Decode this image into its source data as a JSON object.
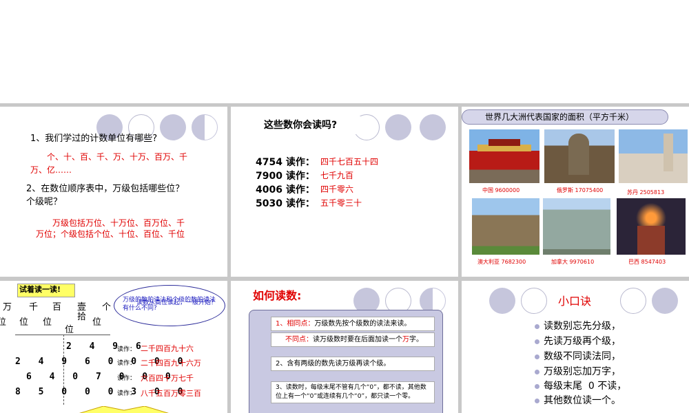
{
  "slide1": {
    "q1": "1、我们学过的计数单位有哪些?",
    "a1": "个、十、百、千、万、十万、百万、千万、亿……",
    "q2": "2、在数位顺序表中，万级包括哪些位？个级呢？",
    "a2": "万级包括万位、十万位、百万位、千万位；个级包括个位、十位、百位、千位"
  },
  "slide2": {
    "title": "这些数你会读吗?",
    "rows": [
      {
        "num": "4754 读作：",
        "ans": "四千七百五十四"
      },
      {
        "num": "7900 读作：",
        "ans": "七千九百"
      },
      {
        "num": "4006 读作：",
        "ans": "四千零六"
      },
      {
        "num": "5030 读作：",
        "ans": "五千零三十"
      }
    ]
  },
  "slide3": {
    "title": "世界几大洲代表国家的面积（平方千米）",
    "captions": [
      "中国  9600000",
      "俄罗斯 17075400",
      "苏丹  2505813",
      "澳大利亚  7682300",
      "加拿大  9970610",
      "巴西  8547403"
    ]
  },
  "slide4": {
    "banner": "试着读一读!",
    "bubble1": "万级的数的读法和个级的数的读法有什么不同?",
    "bubble2": "读数从高位读起，一级开始？",
    "header_top": [
      "万",
      "千",
      "百",
      "壹",
      "个"
    ],
    "header_bottom": [
      "位",
      "位",
      "位",
      "拾",
      "位"
    ],
    "header_extra": "位",
    "numbers": [
      "2 4 9 6",
      "2 4 9 6 0 0 0 0",
      "6 4 0 7 0 0 0",
      "8 5 0 0 0 3 0 0"
    ],
    "read_label": "读作：",
    "answers": [
      "二千四百九十六",
      "二千四百九十六万",
      "六百四十万七千",
      "八千五百万零三百"
    ]
  },
  "slide5": {
    "title": "如何读数:",
    "r1_label": "1、相同点：",
    "r1_text": "万级数先按个级数的读法来读。",
    "r1b_label": "不同点：",
    "r1b_text": "读万级数时要在后面加读一个",
    "r1b_word": "万",
    "r1b_end": "字。",
    "r2": "2、含有两级的数先读万级再读个级。",
    "r3": "3、读数时，每级末尾不管有几个“0”，都不读，其他数位上有一个“0”或连续有几个“0”，都只读一个零。"
  },
  "slide6": {
    "title": "小口诀",
    "lines": [
      "读数别忘先分级，",
      "先读万级再个级，",
      "数级不同读法同，",
      "万级别忘加万字，",
      "每级末尾  0 不读，",
      "其他数位读一个。"
    ]
  },
  "colors": {
    "accent_red": "#e00000",
    "circle_lilac": "#c6c6dc",
    "banner_yellow": "#ffff66"
  }
}
